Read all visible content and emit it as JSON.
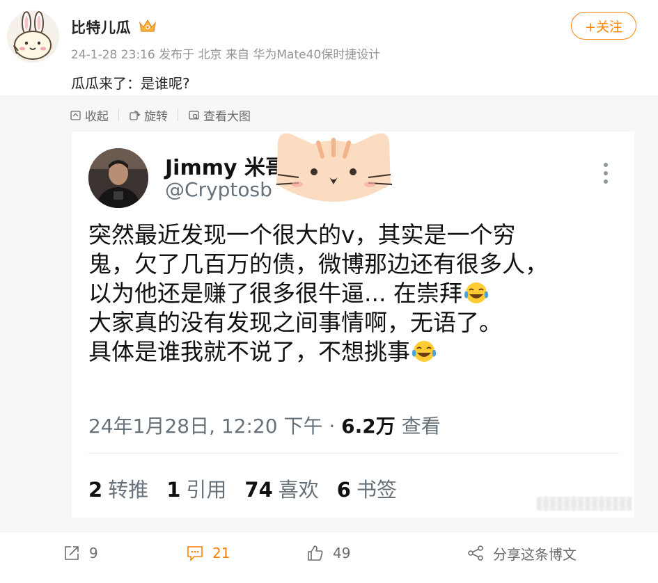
{
  "post": {
    "author": "比特儿瓜",
    "follow_label": "+关注",
    "meta": "24-1-28 23:16 发布于 北京 来自 华为Mate40保时捷设计",
    "text": "瓜瓜来了：是谁呢?"
  },
  "media_toolbar": {
    "collapse": "收起",
    "rotate": "旋转",
    "view_large": "查看大图"
  },
  "tweet": {
    "name": "Jimmy 米哥",
    "handle": "@Cryptosb",
    "lines": [
      "突然最近发现一个很大的v，其实是一个穷",
      "鬼，欠了几百万的债，微博那边还有很多人，",
      "以为他还是赚了很多很牛逼... 在崇拜",
      "大家真的没有发现之间事情啊，无语了。",
      "具体是谁我就不说了，不想挑事"
    ],
    "time": "24年1月28日, 12:20 下午 · ",
    "views_count": "6.2万",
    "views_label": "查看",
    "stats": [
      {
        "num": "2",
        "label": "转推"
      },
      {
        "num": "1",
        "label": "引用"
      },
      {
        "num": "74",
        "label": "喜欢"
      },
      {
        "num": "6",
        "label": "书签"
      }
    ]
  },
  "actions": {
    "repost": "9",
    "comment": "21",
    "like": "49",
    "share": "分享这条博文"
  },
  "colors": {
    "accent": "#ff8200",
    "muted": "#939393",
    "tweet_gray": "#66717a"
  }
}
